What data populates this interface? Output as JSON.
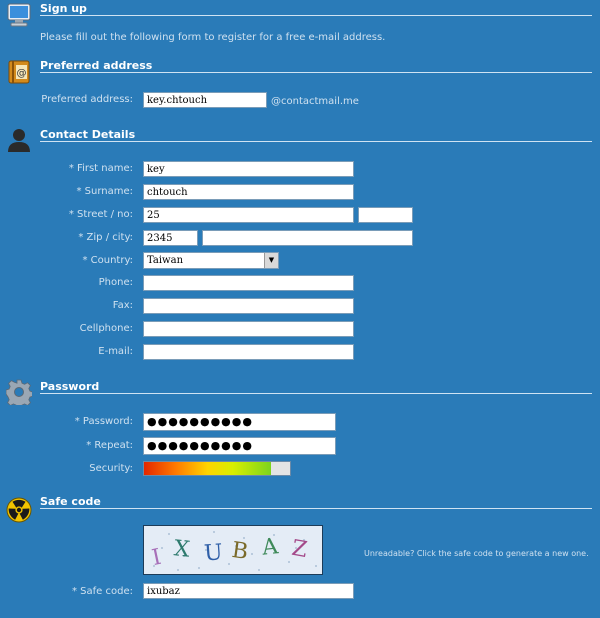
{
  "signup": {
    "title": "Sign up",
    "intro": "Please fill out the following form to register for a free e-mail address."
  },
  "preferred": {
    "title": "Preferred address",
    "label": "Preferred address:",
    "value": "key.chtouch",
    "domain": "@contactmail.me"
  },
  "contact": {
    "title": "Contact Details",
    "first_name_label": "* First name:",
    "first_name_value": "key",
    "surname_label": "* Surname:",
    "surname_value": "chtouch",
    "street_label": "* Street / no:",
    "street_value": "25",
    "street_no_value": "",
    "zip_label": "* Zip / city:",
    "zip_value": "2345",
    "city_value": "",
    "country_label": "* Country:",
    "country_value": "Taiwan",
    "phone_label": "Phone:",
    "phone_value": "",
    "fax_label": "Fax:",
    "fax_value": "",
    "cellphone_label": "Cellphone:",
    "cellphone_value": "",
    "email_label": "E-mail:",
    "email_value": ""
  },
  "password": {
    "title": "Password",
    "password_label": "* Password:",
    "password_value": "●●●●●●●●●●",
    "repeat_label": "* Repeat:",
    "repeat_value": "●●●●●●●●●●",
    "security_label": "Security:",
    "security_level": 0.87
  },
  "safecode": {
    "title": "Safe code",
    "captcha_text": "IXUBAZ",
    "hint": "Unreadable? Click the safe code to generate a new one.",
    "label": "* Safe code:",
    "value": "ixubaz"
  },
  "colors": {
    "background": "#2a7bb8",
    "label_text": "#cfe1f0",
    "section_line": "#cfe3f3"
  },
  "icons": {
    "signup": "monitor-icon",
    "preferred": "address-book-icon",
    "contact": "person-icon",
    "password": "gear-icon",
    "safecode": "radiation-icon"
  }
}
